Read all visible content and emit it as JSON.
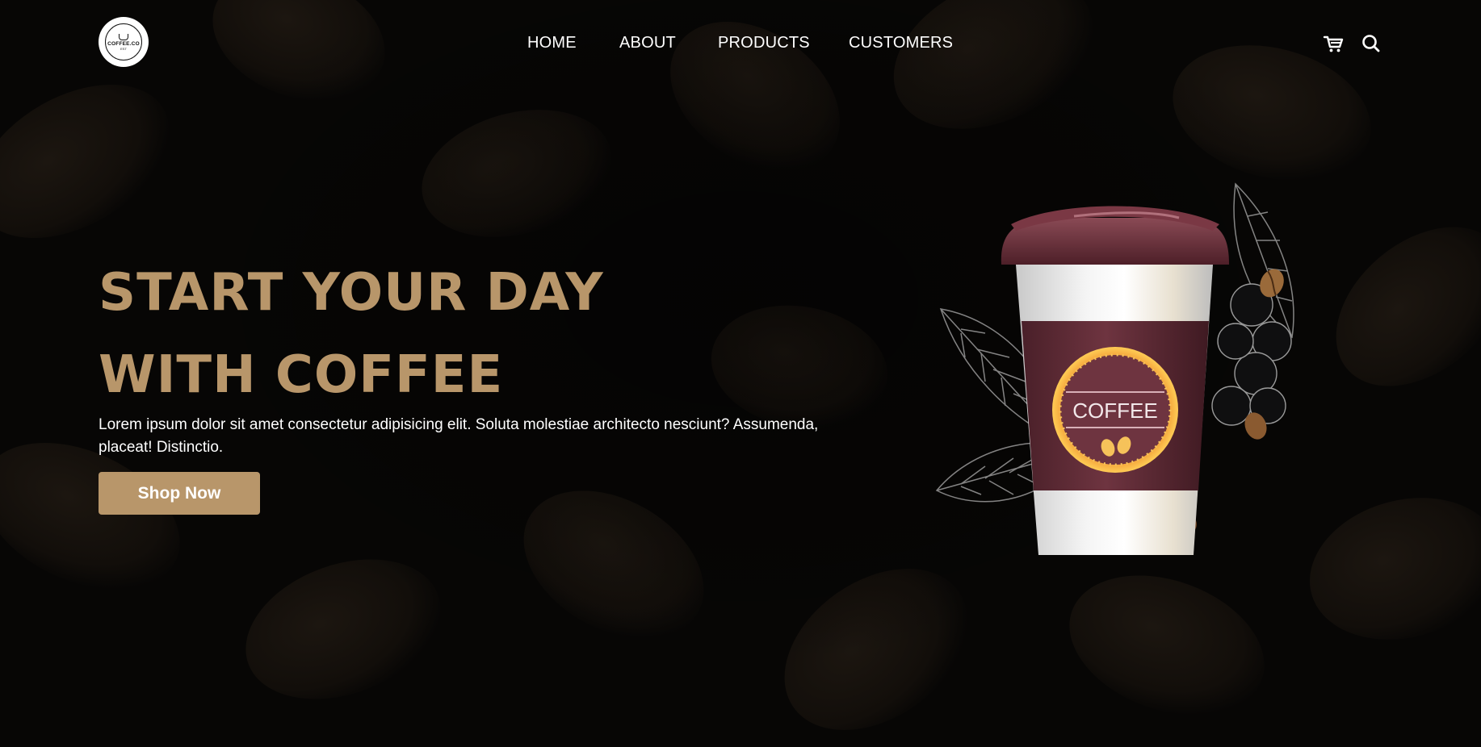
{
  "brand": {
    "logo_text": "COFFEE.CO",
    "logo_sub": "EST"
  },
  "nav": {
    "items": [
      {
        "label": "HOME"
      },
      {
        "label": "ABOUT"
      },
      {
        "label": "PRODUCTS"
      },
      {
        "label": "CUSTOMERS"
      }
    ]
  },
  "icons": {
    "cart": "cart-icon",
    "search": "search-icon"
  },
  "hero": {
    "title_line1": "START YOUR DAY",
    "title_line2": "WITH COFFEE",
    "description": "Lorem ipsum dolor sit amet consectetur adipisicing elit. Soluta molestiae architecto nesciunt? Assumenda, placeat! Distinctio.",
    "cta_label": "Shop Now"
  },
  "cup": {
    "label": "COFFEE"
  },
  "colors": {
    "background": "#070605",
    "accent": "#b8966a",
    "cup_sleeve": "#5e2c36",
    "cup_lid": "#6b2e38",
    "text": "#ffffff"
  }
}
